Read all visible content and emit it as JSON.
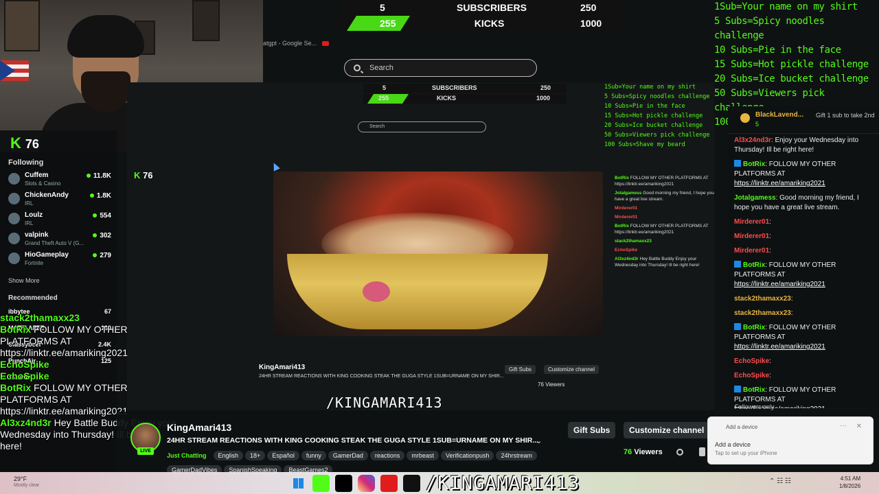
{
  "stats_bar": {
    "row1": {
      "left": "5",
      "label": "SUBSCRIBERS",
      "right": "250"
    },
    "row2": {
      "left": "255",
      "label": "KICKS",
      "right": "1000"
    }
  },
  "browser": {
    "tab_text": "atgpt - Google Se...",
    "search_placeholder": "Search"
  },
  "goals": [
    "1Sub=Your name on my shirt",
    "5 Subs=Spicy noodles challenge",
    "10 Subs=Pie in the face",
    "15 Subs=Hot pickle challenge",
    "20 Subs=Ice bucket challenge",
    "50 Subs=Viewers pick challenge",
    "100 Subs=Shave my beard"
  ],
  "sidebar": {
    "count": "76",
    "following_title": "Following",
    "following": [
      {
        "name": "Cuffem",
        "category": "Slots & Casino",
        "count": "11.8K"
      },
      {
        "name": "ChickenAndy",
        "category": "IRL",
        "count": "1.8K"
      },
      {
        "name": "Loulz",
        "category": "IRL",
        "count": "554"
      },
      {
        "name": "valpink",
        "category": "Grand Theft Auto V (G...",
        "count": "302"
      },
      {
        "name": "HioGameplay",
        "category": "Fortnite",
        "count": "279"
      }
    ],
    "show_more": "Show More",
    "recommended_title": "Recommended",
    "recommended": [
      {
        "name": "ibbytee",
        "count": "67"
      },
      {
        "name": "MATTI AFFE",
        "count": "160"
      },
      {
        "name": "Classybeef",
        "count": "2.4K"
      },
      {
        "name": "PunchAir",
        "count": "125"
      },
      {
        "name": "Twentie",
        "count": ""
      }
    ]
  },
  "overlay_chat": [
    {
      "user": "stack2thamaxx23",
      "text": ""
    },
    {
      "user": "BotRix",
      "text": "FOLLOW MY OTHER PLATFORMS AT https://linktr.ee/amariking2021"
    },
    {
      "user": "EchoSpike",
      "text": ""
    },
    {
      "user": "EchoSpike",
      "text": ""
    },
    {
      "user": "BotRix",
      "text": "FOLLOW MY OTHER PLATFORMS AT https://linktr.ee/amariking2021"
    },
    {
      "user": "Al3xz4nd3r",
      "text": "Hey Battle Buddy Enjoy your Wednesday into Thursday! Ill be right here!"
    }
  ],
  "chat": {
    "pinned": {
      "name": "BlackLavend...",
      "count": "5",
      "gift": "Gift 1 sub to take 2nd"
    },
    "messages": [
      {
        "user": "Al3x24nd3r",
        "color": "#ff4d4d",
        "bot": false,
        "text": "Enjoy your Wednesday into Thursday! Ill be right here!",
        "link": ""
      },
      {
        "user": "BotRix",
        "color": "#53fc18",
        "bot": true,
        "text": "FOLLOW MY OTHER PLATFORMS AT ",
        "link": "https://linktr.ee/amariking2021"
      },
      {
        "user": "Jotalgamess",
        "color": "#53fc18",
        "bot": false,
        "text": "Good morning my friend, I hope you have a great live stream.",
        "link": ""
      },
      {
        "user": "Mirderer01",
        "color": "#ff4d4d",
        "bot": false,
        "text": "",
        "link": ""
      },
      {
        "user": "Mirderer01",
        "color": "#ff4d4d",
        "bot": false,
        "text": "",
        "link": ""
      },
      {
        "user": "Mirderer01",
        "color": "#ff4d4d",
        "bot": false,
        "text": "",
        "link": ""
      },
      {
        "user": "BotRix",
        "color": "#53fc18",
        "bot": true,
        "text": "FOLLOW MY OTHER PLATFORMS AT ",
        "link": "https://linktr.ee/amariking2021"
      },
      {
        "user": "stack2thamaxx23",
        "color": "#e8b53f",
        "bot": false,
        "text": "",
        "link": ""
      },
      {
        "user": "stack2thamaxx23",
        "color": "#e8b53f",
        "bot": false,
        "text": "",
        "link": ""
      },
      {
        "user": "BotRix",
        "color": "#53fc18",
        "bot": true,
        "text": "FOLLOW MY OTHER PLATFORMS AT ",
        "link": "https://linktr.ee/amariking2021"
      },
      {
        "user": "EchoSpike",
        "color": "#ff4d4d",
        "bot": false,
        "text": "",
        "link": ""
      },
      {
        "user": "EchoSpike",
        "color": "#ff4d4d",
        "bot": false,
        "text": "",
        "link": ""
      },
      {
        "user": "BotRix",
        "color": "#53fc18",
        "bot": true,
        "text": "FOLLOW MY OTHER PLATFORMS AT ",
        "link": "https://linktr.ee/amariking2021"
      },
      {
        "user": "Al3x24nd3r",
        "color": "#53fc18",
        "bot": false,
        "text": "Hey Battle Buddy Enjoy your Wednesday into Thursday! Ill be right here!",
        "link": ""
      }
    ],
    "followers_only": "Followers only"
  },
  "stream": {
    "name": "KingAmari413",
    "title": "24HR STREAM REACTIONS WITH KING COOKING STEAK THE GUGA STYLE 1SUB=URNAME ON MY SHIR...",
    "live": "LIVE",
    "tags": [
      "Just Chatting",
      "English",
      "18+",
      "Español",
      "funny",
      "GamerDad",
      "reactions",
      "mrbeast",
      "Verificationpush",
      "24hrstream",
      "GamerDadVibes",
      "SpanishSpeaking",
      "BeastGames2"
    ],
    "gift_subs": "Gift Subs",
    "customize": "Customize channel",
    "viewers": "76",
    "viewers_label": "Viewers"
  },
  "nested": {
    "chat_snippets": [
      {
        "u": "BotRix",
        "t": "FOLLOW MY OTHER PLATFORMS AT https://linktr.ee/amariking2021"
      },
      {
        "u": "Jotalgamess",
        "t": "Good morning my friend, I hope you have a great live stream."
      },
      {
        "u": "Mirderer01",
        "t": ""
      },
      {
        "u": "Mirderer01",
        "t": ""
      },
      {
        "u": "BotRix",
        "t": "FOLLOW MY OTHER PLATFORMS AT https://linktr.ee/amariking2021"
      },
      {
        "u": "stack2thamaxx23",
        "t": ""
      },
      {
        "u": "EchoSpike",
        "t": ""
      },
      {
        "u": "Al3xz4nd3r",
        "t": "Hey Battle Buddy Enjoy your Wednesday into Thursday! Ill be right here!"
      }
    ],
    "social": "/KINGAMARI413",
    "gift_subs": "Gift Subs",
    "customize": "Customize channel",
    "viewers": "76 Viewers"
  },
  "social_handle": "/KINGAMARI413",
  "toast": {
    "header": "Add a device",
    "title": "Add a device",
    "sub": "Tap to set up your iPhone"
  },
  "taskbar": {
    "weather_temp": "29°F",
    "weather_desc": "Mostly clear",
    "time": "4:51 AM",
    "date": "1/8/2026"
  }
}
